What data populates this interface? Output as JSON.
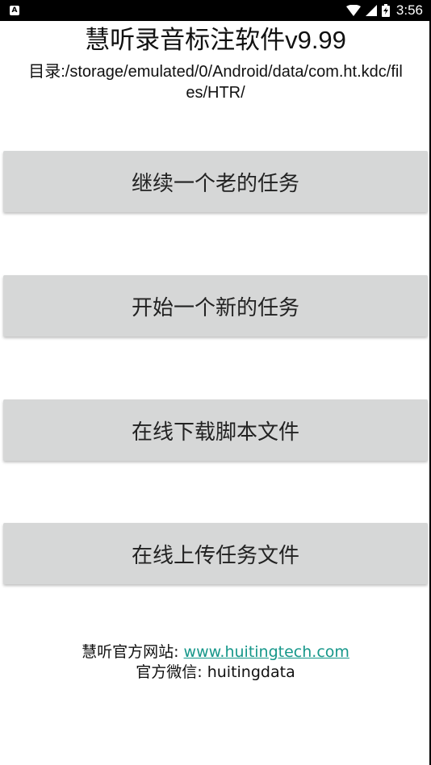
{
  "status_bar": {
    "notification_icon": "android-a-icon",
    "icons": [
      "wifi-icon",
      "signal-icon",
      "battery-charging-icon"
    ],
    "time": "3:56"
  },
  "header": {
    "title": "慧听录音标注软件v9.99",
    "directory": "目录:/storage/emulated/0/Android/data/com.ht.kdc/files/HTR/"
  },
  "buttons": {
    "continue_task": "继续一个老的任务",
    "new_task": "开始一个新的任务",
    "download_scripts": "在线下载脚本文件",
    "upload_tasks": "在线上传任务文件"
  },
  "footer": {
    "website_label": "慧听官方网站: ",
    "website_link": "www.huitingtech.com",
    "wechat_label": "官方微信: ",
    "wechat_id": "huitingdata"
  },
  "colors": {
    "button_bg": "#d6d7d7",
    "link": "#16978a",
    "status_bar": "#000000"
  }
}
